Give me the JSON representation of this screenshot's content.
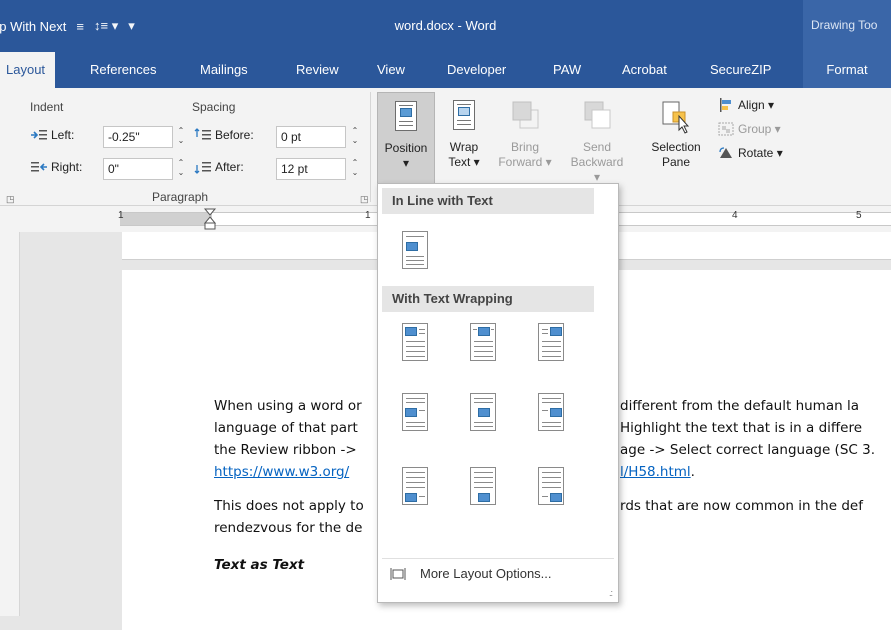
{
  "titlebar": {
    "qat_label": "ep With Next",
    "doc_title": "word.docx - Word",
    "context_title": "Drawing Too"
  },
  "tabs": [
    "Layout",
    "References",
    "Mailings",
    "Review",
    "View",
    "Developer",
    "PAW",
    "Acrobat",
    "SecureZIP",
    "Format"
  ],
  "paragraph_group": {
    "indent_label": "Indent",
    "spacing_label": "Spacing",
    "left_label": "Left:",
    "left_value": "-0.25\"",
    "right_label": "Right:",
    "right_value": "0\"",
    "before_label": "Before:",
    "before_value": "0 pt",
    "after_label": "After:",
    "after_value": "12 pt",
    "group_label": "Paragraph"
  },
  "arrange_group": {
    "position": {
      "line1": "Position",
      "line2": "▾"
    },
    "wrap_text": {
      "line1": "Wrap",
      "line2": "Text ▾"
    },
    "bring_forward": {
      "line1": "Bring",
      "line2": "Forward ▾"
    },
    "send_backward": {
      "line1": "Send",
      "line2": "Backward ▾"
    },
    "selection_pane": {
      "line1": "Selection",
      "line2": "Pane"
    },
    "align": "Align ▾",
    "group": "Group ▾",
    "rotate": "Rotate ▾"
  },
  "ruler": {
    "numbers": [
      "1",
      "1",
      "4",
      "5"
    ]
  },
  "dropdown": {
    "inline_header": "In Line with Text",
    "wrapping_header": "With Text Wrapping",
    "more_options": "More Layout Options..."
  },
  "document": {
    "p1_line1_a": "When using a word or",
    "p1_line1_b": "different from the default human la",
    "p1_line2_a": "language of that part",
    "p1_line2_b": "Highlight the text that is in a differe",
    "p1_line3_a": "the Review ribbon ->",
    "p1_line3_b": "age -> Select correct language (SC 3.",
    "p1_link_a": "https://www.w3.org/",
    "p1_link_b": "l/H58.html",
    "p1_link_end": ".",
    "p2_line1_a": "This does not apply to",
    "p2_line1_b": "rds that are now common in the def",
    "p2_line2_a": "rendezvous for the de",
    "heading": "Text as Text"
  },
  "colors": {
    "ribbon_blue": "#2b579a",
    "context_blue": "#3a66a8"
  }
}
